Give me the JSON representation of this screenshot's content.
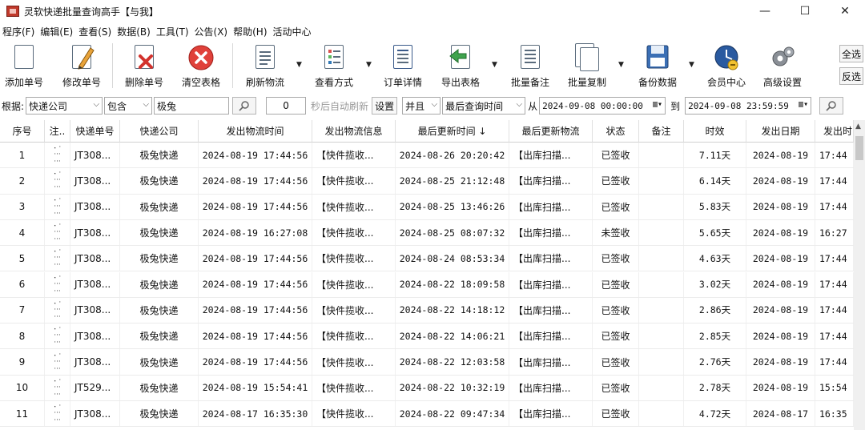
{
  "window": {
    "title": "灵软快递批量查询高手【与我】",
    "controls": [
      "—",
      "☐",
      "✕"
    ]
  },
  "menu": [
    "程序(F)",
    "编辑(E)",
    "查看(S)",
    "数据(B)",
    "工具(T)",
    "公告(X)",
    "帮助(H)",
    "活动中心"
  ],
  "toolbar": {
    "add": "添加单号",
    "edit": "修改单号",
    "delete": "删除单号",
    "clear": "清空表格",
    "refresh": "刷新物流",
    "view": "查看方式",
    "detail": "订单详情",
    "export": "导出表格",
    "batch_note": "批量备注",
    "batch_copy": "批量复制",
    "backup": "备份数据",
    "member": "会员中心",
    "advanced": "高级设置",
    "select_all": "全选",
    "invert": "反选"
  },
  "filter": {
    "label": "根据:",
    "field": "快递公司",
    "op": "包含",
    "value": "极兔",
    "seconds": "0",
    "auto_refresh_hint": "秒后自动刷新",
    "set_btn": "设置",
    "logic": "并且",
    "time_field": "最后查询时间",
    "from_label": "从",
    "from": "2024-09-08 00:00:00",
    "to_label": "到",
    "to": "2024-09-08 23:59:59"
  },
  "table": {
    "headers": [
      "序号",
      "注..",
      "快递单号",
      "快递公司",
      "发出物流时间",
      "发出物流信息",
      "最后更新时间 ↓",
      "最后更新物流",
      "状态",
      "备注",
      "时效",
      "发出日期",
      "发出时"
    ],
    "rows": [
      [
        "1",
        "JT308...",
        "极兔快递",
        "2024-08-19 17:44:56",
        "【快件揽收...",
        "2024-08-26 20:20:42",
        "【出库扫描...",
        "已签收",
        "",
        "7.11天",
        "2024-08-19",
        "17:44"
      ],
      [
        "2",
        "JT308...",
        "极兔快递",
        "2024-08-19 17:44:56",
        "【快件揽收...",
        "2024-08-25 21:12:48",
        "【出库扫描...",
        "已签收",
        "",
        "6.14天",
        "2024-08-19",
        "17:44"
      ],
      [
        "3",
        "JT308...",
        "极兔快递",
        "2024-08-19 17:44:56",
        "【快件揽收...",
        "2024-08-25 13:46:26",
        "【出库扫描...",
        "已签收",
        "",
        "5.83天",
        "2024-08-19",
        "17:44"
      ],
      [
        "4",
        "JT308...",
        "极兔快递",
        "2024-08-19 16:27:08",
        "【快件揽收...",
        "2024-08-25 08:07:32",
        "【出库扫描...",
        "未签收",
        "",
        "5.65天",
        "2024-08-19",
        "16:27"
      ],
      [
        "5",
        "JT308...",
        "极兔快递",
        "2024-08-19 17:44:56",
        "【快件揽收...",
        "2024-08-24 08:53:34",
        "【出库扫描...",
        "已签收",
        "",
        "4.63天",
        "2024-08-19",
        "17:44"
      ],
      [
        "6",
        "JT308...",
        "极兔快递",
        "2024-08-19 17:44:56",
        "【快件揽收...",
        "2024-08-22 18:09:58",
        "【出库扫描...",
        "已签收",
        "",
        "3.02天",
        "2024-08-19",
        "17:44"
      ],
      [
        "7",
        "JT308...",
        "极兔快递",
        "2024-08-19 17:44:56",
        "【快件揽收...",
        "2024-08-22 14:18:12",
        "【出库扫描...",
        "已签收",
        "",
        "2.86天",
        "2024-08-19",
        "17:44"
      ],
      [
        "8",
        "JT308...",
        "极兔快递",
        "2024-08-19 17:44:56",
        "【快件揽收...",
        "2024-08-22 14:06:21",
        "【出库扫描...",
        "已签收",
        "",
        "2.85天",
        "2024-08-19",
        "17:44"
      ],
      [
        "9",
        "JT308...",
        "极兔快递",
        "2024-08-19 17:44:56",
        "【快件揽收...",
        "2024-08-22 12:03:58",
        "【出库扫描...",
        "已签收",
        "",
        "2.76天",
        "2024-08-19",
        "17:44"
      ],
      [
        "10",
        "JT529...",
        "极兔快递",
        "2024-08-19 15:54:41",
        "【快件揽收...",
        "2024-08-22 10:32:19",
        "【出库扫描...",
        "已签收",
        "",
        "2.78天",
        "2024-08-19",
        "15:54"
      ],
      [
        "11",
        "JT308...",
        "极兔快递",
        "2024-08-17 16:35:30",
        "【快件揽收...",
        "2024-08-22 09:47:34",
        "【出库扫描...",
        "已签收",
        "",
        "4.72天",
        "2024-08-17",
        "16:35"
      ]
    ]
  }
}
